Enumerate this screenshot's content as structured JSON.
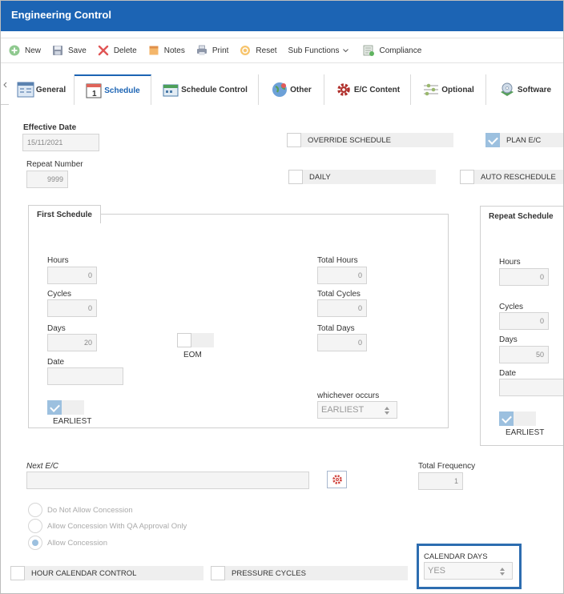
{
  "window": {
    "title": "Engineering Control"
  },
  "toolbar": {
    "new": "New",
    "save": "Save",
    "delete": "Delete",
    "notes": "Notes",
    "print": "Print",
    "reset": "Reset",
    "sub_functions": "Sub Functions",
    "compliance": "Compliance"
  },
  "tabs": {
    "general": "General",
    "schedule": "Schedule",
    "schedule_control": "Schedule Control",
    "other": "Other",
    "ec_content": "E/C Content",
    "optional": "Optional",
    "software": "Software"
  },
  "form": {
    "effective_date_label": "Effective Date",
    "effective_date_value": "15/11/2021",
    "repeat_number_label": "Repeat Number",
    "repeat_number_value": "9999",
    "override_schedule": "OVERRIDE SCHEDULE",
    "plan_ec": "PLAN E/C",
    "daily": "DAILY",
    "auto_reschedule": "AUTO RESCHEDULE"
  },
  "first_schedule": {
    "title": "First Schedule",
    "hours_label": "Hours",
    "hours_value": "0",
    "cycles_label": "Cycles",
    "cycles_value": "0",
    "days_label": "Days",
    "days_value": "20",
    "date_label": "Date",
    "date_value": "",
    "eom_label": "EOM",
    "earliest_label": "EARLIEST",
    "total_hours_label": "Total Hours",
    "total_hours_value": "0",
    "total_cycles_label": "Total Cycles",
    "total_cycles_value": "0",
    "total_days_label": "Total Days",
    "total_days_value": "0",
    "whichever_label": "whichever occurs",
    "whichever_value": "EARLIEST"
  },
  "repeat_schedule": {
    "title": "Repeat Schedule",
    "hours_label": "Hours",
    "hours_value": "0",
    "cycles_label": "Cycles",
    "cycles_value": "0",
    "days_label": "Days",
    "days_value": "50",
    "date_label": "Date",
    "date_value": "",
    "earliest_label": "EARLIEST"
  },
  "next_ec": {
    "label": "Next E/C",
    "value": ""
  },
  "total_frequency": {
    "label": "Total Frequency",
    "value": "1"
  },
  "concession": {
    "opt1": "Do Not Allow Concession",
    "opt2": "Allow Concession With QA Approval Only",
    "opt3": "Allow Concession"
  },
  "bottom": {
    "hour_calendar_control": "HOUR CALENDAR CONTROL",
    "pressure_cycles": "PRESSURE CYCLES",
    "calendar_days_label": "CALENDAR DAYS",
    "calendar_days_value": "YES"
  },
  "colors": {
    "title_bar": "#1c64b4",
    "highlight_box": "#2d6db0",
    "checked": "#9cc0df"
  }
}
